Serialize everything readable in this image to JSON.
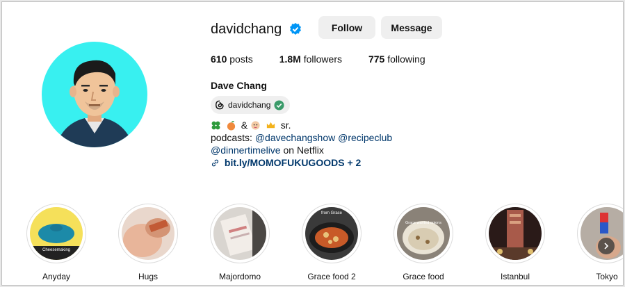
{
  "profile": {
    "username": "davidchang",
    "full_name": "Dave Chang",
    "avatar_icon": "cartoon-avatar",
    "avatar_bg": "#38f0f0",
    "verified_color": "#0095f6"
  },
  "actions": {
    "follow": "Follow",
    "message": "Message"
  },
  "stats": {
    "posts": "610",
    "posts_label": "posts",
    "followers": "1.8M",
    "followers_label": "followers",
    "following": "775",
    "following_label": "following"
  },
  "threads_badge": {
    "handle": "davidchang",
    "icon": "threads-icon"
  },
  "bio": {
    "emoji_line_amp": "&",
    "emoji_line_suffix": "sr.",
    "podcasts_prefix": "podcasts: ",
    "mention1": "@davechangshow",
    "mention2": "@recipeclub",
    "mention3": "@dinnertimelive",
    "on_netflix": " on Netflix",
    "link": "bit.ly/MOMOFUKUGOODS",
    "link_more": " + 2"
  },
  "highlights": [
    {
      "label": "Anyday",
      "thumb_text": "Cheesemaking"
    },
    {
      "label": "Hugs"
    },
    {
      "label": "Majordomo"
    },
    {
      "label": "Grace food 2",
      "thumb_text": "from Grace"
    },
    {
      "label": "Grace food",
      "thumb_text": "Grace wanted onions"
    },
    {
      "label": "Istanbul"
    },
    {
      "label": "Tokyo"
    }
  ],
  "colors": {
    "link": "#00376b",
    "button_bg": "#efefef"
  }
}
